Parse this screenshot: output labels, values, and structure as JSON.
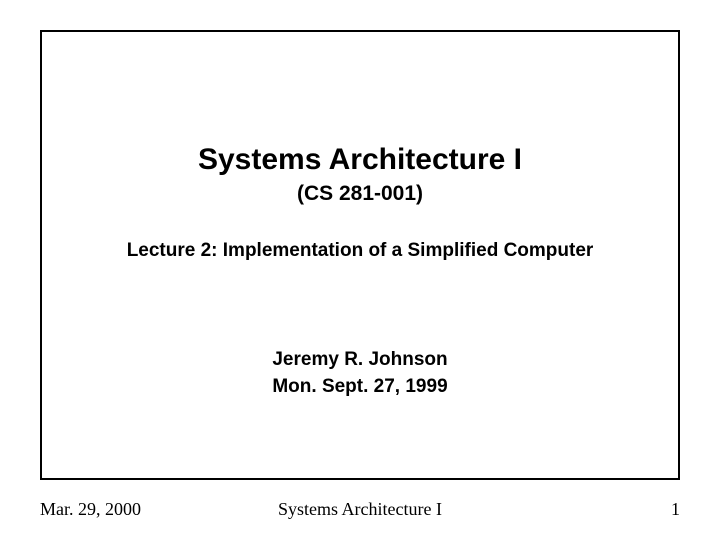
{
  "slide": {
    "course_title": "Systems Architecture I",
    "course_code": "(CS 281-001)",
    "lecture_title": "Lecture 2:  Implementation of a Simplified Computer",
    "author_name": "Jeremy R. Johnson",
    "author_date": "Mon. Sept. 27, 1999"
  },
  "footer": {
    "date": "Mar. 29, 2000",
    "title": "Systems Architecture I",
    "page": "1"
  }
}
